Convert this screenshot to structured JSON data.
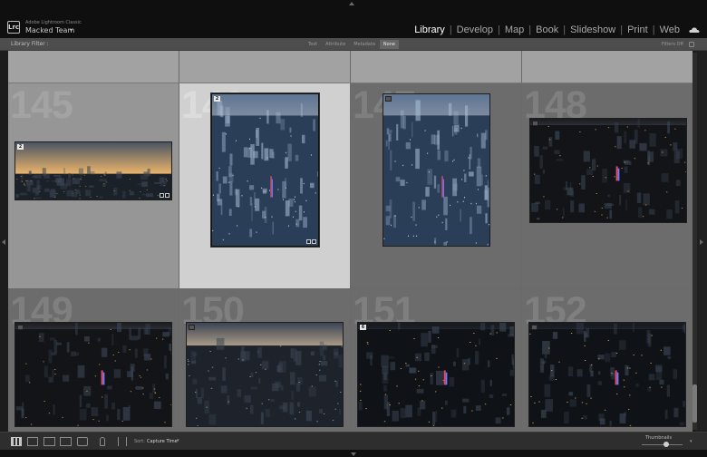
{
  "identity": {
    "app_name": "Adobe Lightroom Classic",
    "team": "Macked Team",
    "logo": "Lrc"
  },
  "modules": [
    {
      "label": "Library",
      "active": true
    },
    {
      "label": "Develop",
      "active": false
    },
    {
      "label": "Map",
      "active": false
    },
    {
      "label": "Book",
      "active": false
    },
    {
      "label": "Slideshow",
      "active": false
    },
    {
      "label": "Print",
      "active": false
    },
    {
      "label": "Web",
      "active": false
    }
  ],
  "filter_bar": {
    "label": "Library Filter :",
    "options": [
      {
        "label": "Text",
        "active": false
      },
      {
        "label": "Attribute",
        "active": false
      },
      {
        "label": "Metadata",
        "active": false
      },
      {
        "label": "None",
        "active": true
      }
    ],
    "status": "Filters Off"
  },
  "grid": {
    "cells": [
      {
        "number": "145",
        "state": "normal",
        "badge": "2",
        "scene": "sunset"
      },
      {
        "number": "146",
        "state": "selected",
        "badge": "2",
        "scene": "city-day"
      },
      {
        "number": "147",
        "state": "dim",
        "badge": "",
        "scene": "city-day"
      },
      {
        "number": "148",
        "state": "dim",
        "badge": "",
        "scene": "night"
      },
      {
        "number": "149",
        "state": "dim",
        "badge": "",
        "scene": "night"
      },
      {
        "number": "150",
        "state": "dim",
        "badge": "",
        "scene": "dusk"
      },
      {
        "number": "151",
        "state": "dim",
        "badge": "6",
        "scene": "night-wide"
      },
      {
        "number": "152",
        "state": "dim",
        "badge": "",
        "scene": "night-wide"
      }
    ]
  },
  "toolbar": {
    "sort_label": "Sort:",
    "sort_value": "Capture Time",
    "thumbnails_label": "Thumbnails",
    "thumbnail_size": 0.6
  },
  "colors": {
    "active_module": "#ffffff",
    "selected_cell": "#d0d0d0",
    "normal_cell": "#969696",
    "dim_cell": "#6c6c6c"
  }
}
